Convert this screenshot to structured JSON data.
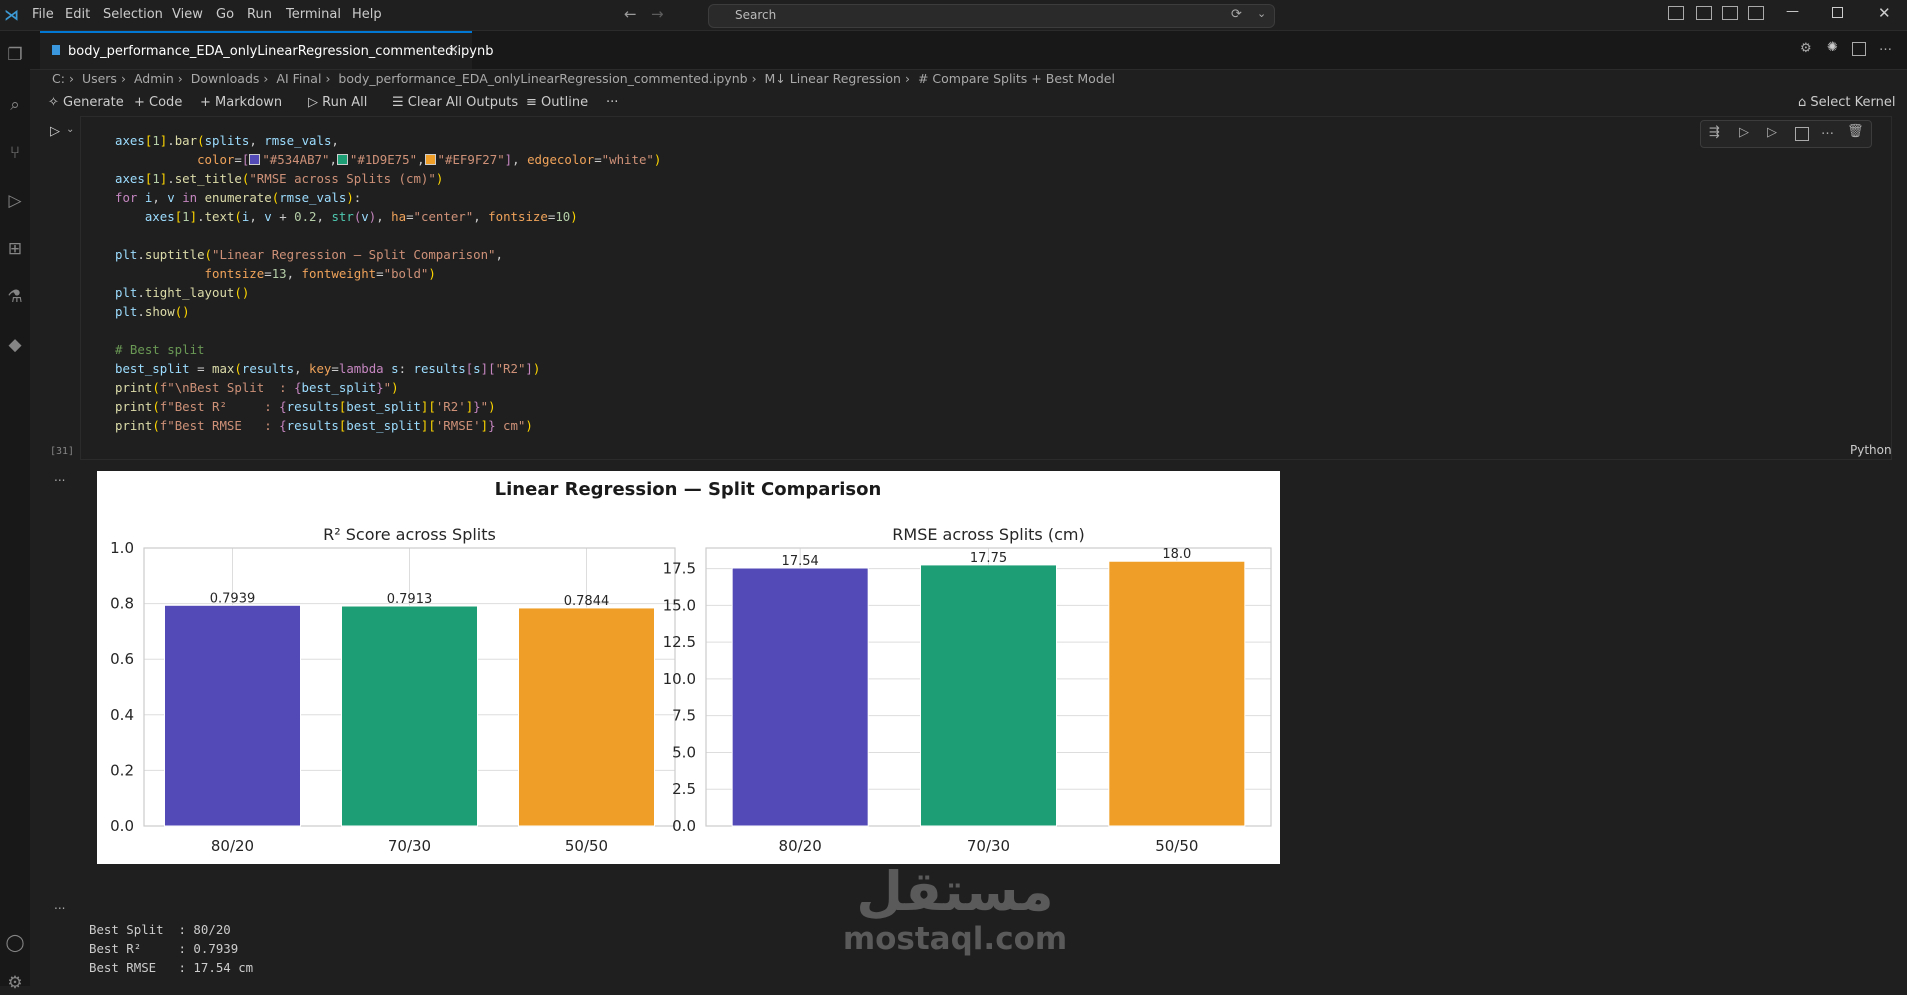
{
  "menu": [
    "File",
    "Edit",
    "Selection",
    "View",
    "Go",
    "Run",
    "Terminal",
    "Help"
  ],
  "search": {
    "placeholder": "Search"
  },
  "tab": {
    "filename": "body_performance_EDA_onlyLinearRegression_commented.ipynb"
  },
  "breadcrumb": [
    "C:",
    "Users",
    "Admin",
    "Downloads",
    "AI Final",
    "body_performance_EDA_onlyLinearRegression_commented.ipynb",
    "M↓ Linear Regression",
    "# Compare Splits + Best Model"
  ],
  "toolbar": {
    "generate": "Generate",
    "code": "Code",
    "markdown": "Markdown",
    "run_all": "Run All",
    "clear": "Clear All Outputs",
    "outline": "Outline",
    "kernel": "Select Kernel"
  },
  "cell": {
    "exec_count": "[31]",
    "language": "Python",
    "output_dots": "..."
  },
  "colors": {
    "bar1": "#534AB7",
    "bar2": "#1D9E75",
    "bar3": "#EF9F27",
    "accent": "#0078d4"
  },
  "chart_data": [
    {
      "type": "bar",
      "suptitle": "Linear Regression — Split Comparison",
      "title": "R² Score across Splits",
      "categories": [
        "80/20",
        "70/30",
        "50/50"
      ],
      "values": [
        0.7939,
        0.7913,
        0.7844
      ],
      "value_labels": [
        "0.7939",
        "0.7913",
        "0.7844"
      ],
      "ylim": [
        0,
        1.0
      ],
      "yticks": [
        "0.0",
        "0.2",
        "0.4",
        "0.6",
        "0.8",
        "1.0"
      ],
      "grid": true
    },
    {
      "type": "bar",
      "title": "RMSE across Splits (cm)",
      "categories": [
        "80/20",
        "70/30",
        "50/50"
      ],
      "values": [
        17.54,
        17.75,
        18.0
      ],
      "value_labels": [
        "17.54",
        "17.75",
        "18.0"
      ],
      "ylim": [
        0,
        18.9
      ],
      "yticks": [
        "0.0",
        "2.5",
        "5.0",
        "7.5",
        "10.0",
        "12.5",
        "15.0",
        "17.5"
      ],
      "grid": true
    }
  ],
  "stdout": [
    "Best Split  : 80/20",
    "Best R²     : 0.7939",
    "Best RMSE   : 17.54 cm"
  ],
  "watermark": {
    "arabic": "مستقل",
    "latin": "mostaql.com"
  }
}
